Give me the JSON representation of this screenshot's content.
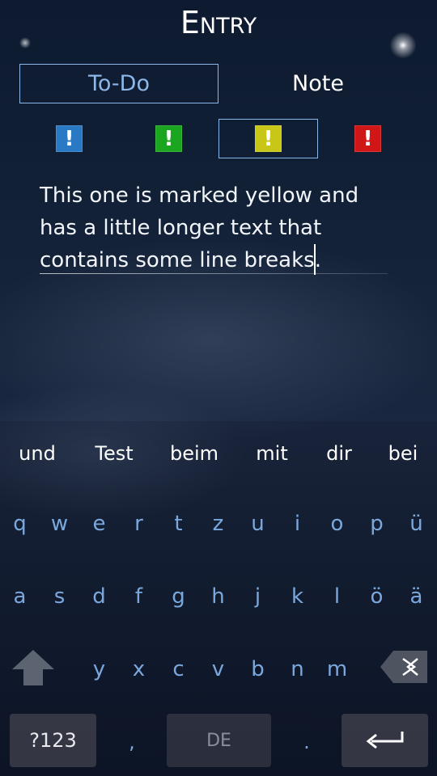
{
  "header": {
    "title": "Entry"
  },
  "type_selector": {
    "todo": "To-Do",
    "note": "Note",
    "selected": "todo"
  },
  "priorities": [
    {
      "name": "blue",
      "color": "#2a79c4",
      "glyph": "!"
    },
    {
      "name": "green",
      "color": "#1aa61f",
      "glyph": "!"
    },
    {
      "name": "yellow",
      "color": "#c8c617",
      "glyph": "!",
      "selected": true
    },
    {
      "name": "red",
      "color": "#d01617",
      "glyph": "!"
    }
  ],
  "entry": {
    "text": "This one is marked yellow and\nhas a little longer text that\ncontains some line breaks."
  },
  "keyboard": {
    "suggestions": [
      "und",
      "Test",
      "beim",
      "mit",
      "dir",
      "bei"
    ],
    "row1": [
      "q",
      "w",
      "e",
      "r",
      "t",
      "z",
      "u",
      "i",
      "o",
      "p",
      "ü"
    ],
    "row2": [
      "a",
      "s",
      "d",
      "f",
      "g",
      "h",
      "j",
      "k",
      "l",
      "ö",
      "ä"
    ],
    "row3": [
      "y",
      "x",
      "c",
      "v",
      "b",
      "n",
      "m"
    ],
    "symbols_label": "?123",
    "comma": ",",
    "language_label": "DE",
    "period": ".",
    "accent_color": "#7ba8dc"
  }
}
